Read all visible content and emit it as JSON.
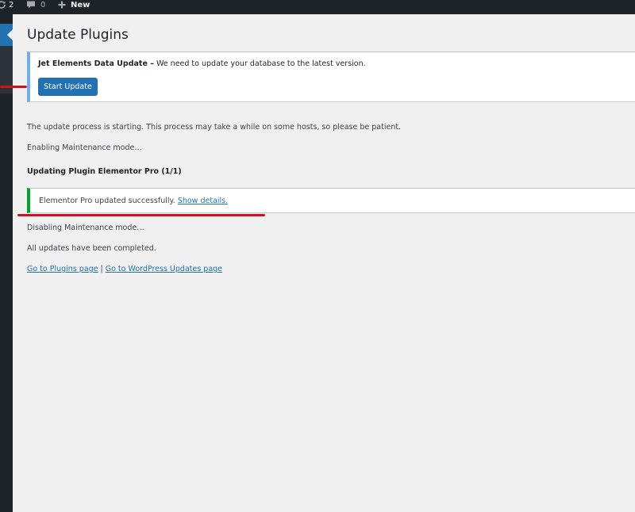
{
  "adminbar": {
    "updates_count": "2",
    "comments_count": "0",
    "new_label": "New"
  },
  "page": {
    "title": "Update Plugins"
  },
  "notice": {
    "strong": "Jet Elements Data Update –",
    "text": " We need to update your database to the latest version.",
    "button_label": "Start Update",
    "accent": "#72aee6"
  },
  "log": {
    "starting": "The update process is starting. This process may take a while on some hosts, so please be patient.",
    "enabling": "Enabling Maintenance mode…",
    "updating_heading": "Updating Plugin Elementor Pro (1/1)",
    "success_text": "Elementor Pro updated successfully.",
    "show_details": "Show details.",
    "disabling": "Disabling Maintenance mode…",
    "completed": "All updates have been completed.",
    "success_accent": "#00a32a"
  },
  "links": {
    "plugins_page": "Go to Plugins page",
    "separator": "|",
    "updates_page": "Go to WordPress Updates page"
  },
  "colors": {
    "adminbar_bg": "#1d2327",
    "primary": "#2271b1",
    "annotation": "#d0111b",
    "page_bg": "#f0f0f1"
  }
}
